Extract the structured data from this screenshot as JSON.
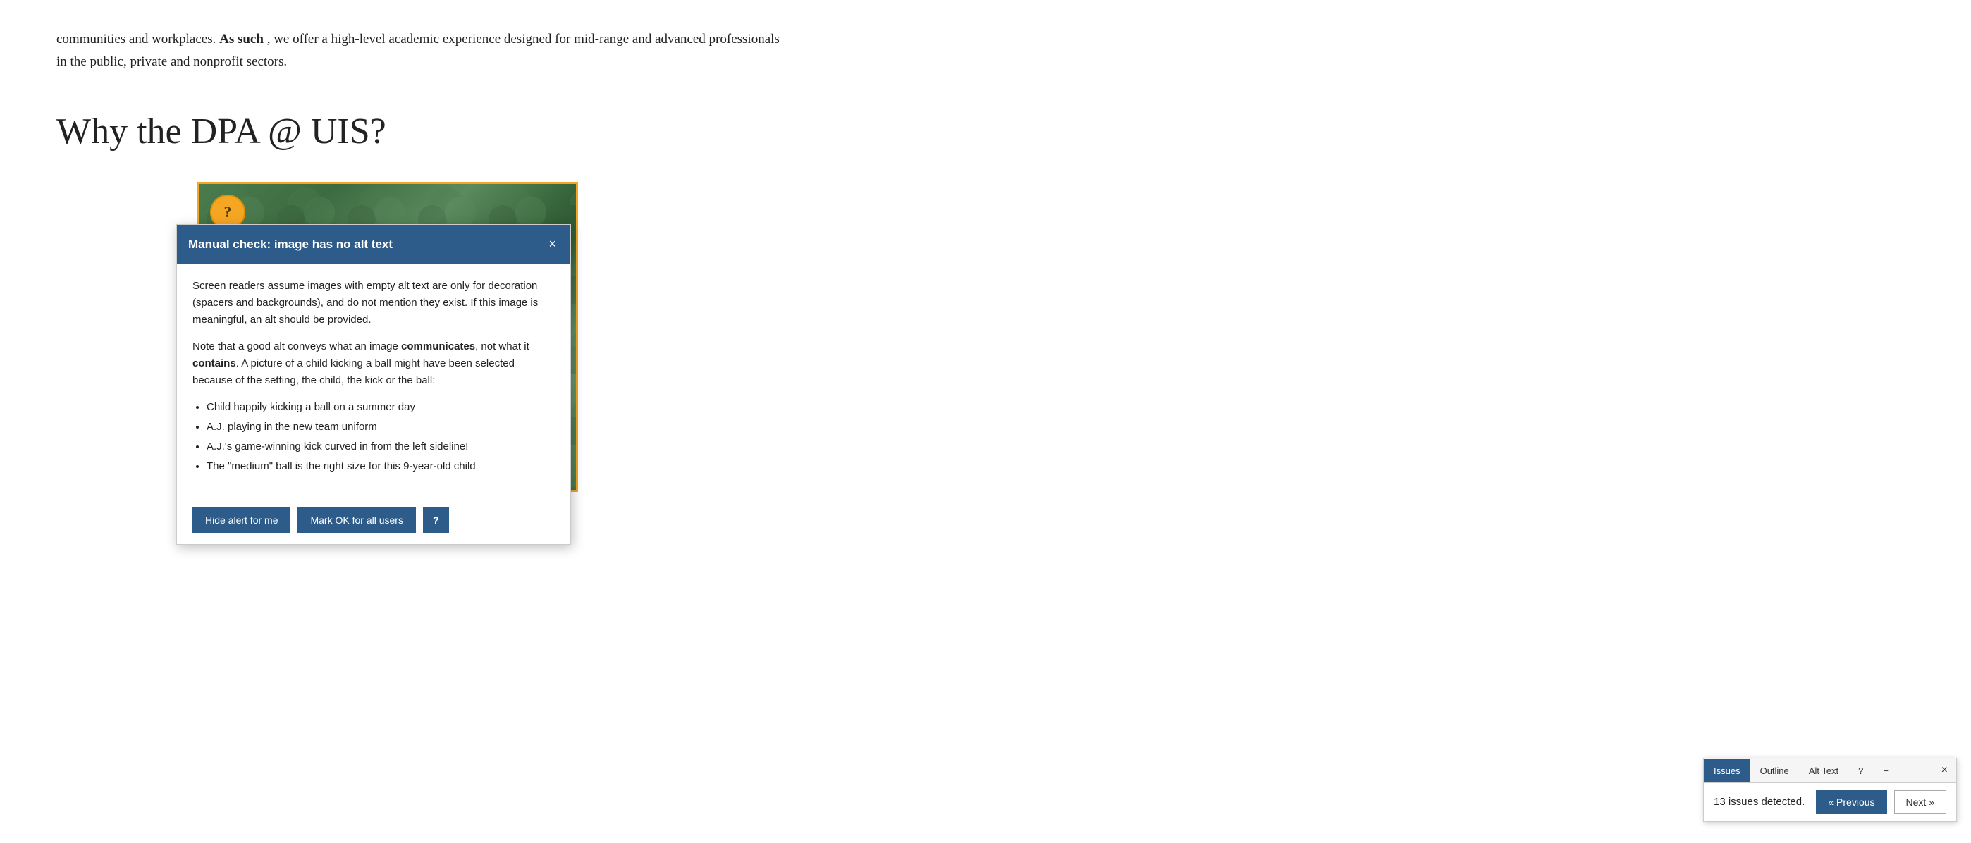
{
  "page": {
    "intro_text_1": "communities and workplaces.",
    "intro_bold": "As such",
    "intro_text_2": ", we offer a high-level academic experience designed for mid-range and advanced professionals in the public, private and nonprofit sectors.",
    "section_heading": "Why the DPA @ UIS?"
  },
  "modal": {
    "title": "Manual check: image has no alt text",
    "close_label": "×",
    "body_p1": "Screen readers assume images with empty alt text are only for decoration (spacers and backgrounds), and do not mention they exist. If this image is meaningful, an alt should be provided.",
    "body_p2_prefix": "Note that a good alt conveys what an image ",
    "body_p2_bold1": "communicates",
    "body_p2_middle": ", not what it ",
    "body_p2_bold2": "contains",
    "body_p2_suffix": ". A picture of a child kicking a ball might have been selected because of the setting, the child, the kick or the ball:",
    "list_items": [
      "Child happily kicking a ball on a summer day",
      "A.J. playing in the new team uniform",
      "A.J.'s game-winning kick curved in from the left sideline!",
      "The \"medium\" ball is the right size for this 9-year-old child"
    ],
    "btn_hide_label": "Hide alert for me",
    "btn_mark_ok_label": "Mark OK for all users",
    "btn_question_label": "?"
  },
  "question_badge": {
    "label": "?"
  },
  "toolbar": {
    "tabs": [
      {
        "label": "Issues",
        "active": true
      },
      {
        "label": "Outline",
        "active": false
      },
      {
        "label": "Alt Text",
        "active": false
      },
      {
        "label": "?",
        "active": false
      },
      {
        "label": "−",
        "active": false
      }
    ],
    "close_label": "×",
    "issues_count_text": "13 issues detected.",
    "btn_previous_label": "« Previous",
    "btn_next_label": "Next »"
  }
}
